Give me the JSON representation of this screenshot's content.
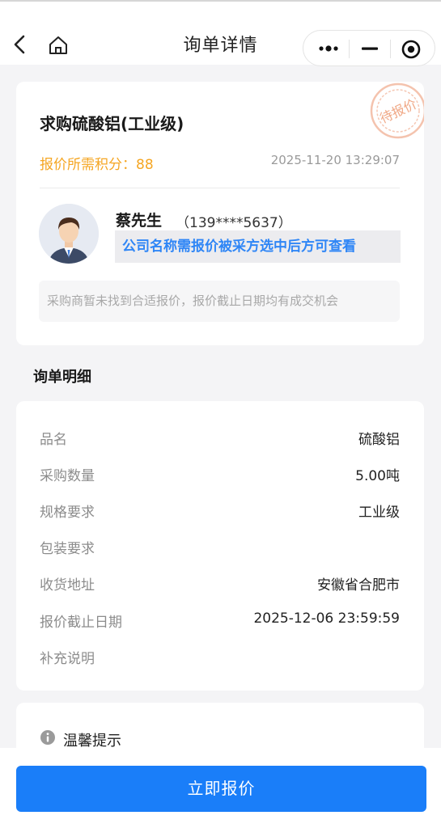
{
  "nav": {
    "title": "询单详情",
    "back_icon": "back-arrow-icon",
    "home_icon": "home-icon",
    "capsule_icons": [
      "more-icon",
      "minimize-icon",
      "target-icon"
    ]
  },
  "inquiry": {
    "product_title": "求购硫酸铝(工业级)",
    "points_label": "报价所需积分：88",
    "datetime": "2025-11-20 13:29:07",
    "stamp_text": "待报价",
    "contact": {
      "name": "蔡先生",
      "phone": "（139****5637）",
      "company_hint": "公司名称需报价被采方选中后方可查看"
    },
    "notice": "采购商暂未找到合适报价，报价截止日期均有成交机会"
  },
  "details": {
    "section_title": "询单明细",
    "rows": [
      {
        "label": "品名",
        "value": "硫酸铝"
      },
      {
        "label": "采购数量",
        "value": "5.00吨"
      },
      {
        "label": "规格要求",
        "value": "工业级"
      },
      {
        "label": "包装要求",
        "value": ""
      },
      {
        "label": "收货地址",
        "value": "安徽省合肥市"
      },
      {
        "label": "报价截止日期",
        "value": "2025-12-06 23:59:59"
      },
      {
        "label": "补充说明",
        "value": ""
      }
    ]
  },
  "tips": {
    "title": "温馨提示"
  },
  "footer": {
    "submit_label": "立即报价"
  },
  "colors": {
    "accent": "#1a7ef9",
    "points": "#f5a623",
    "stamp": "#f2b9a0",
    "company_hint": "#2f86f6"
  }
}
